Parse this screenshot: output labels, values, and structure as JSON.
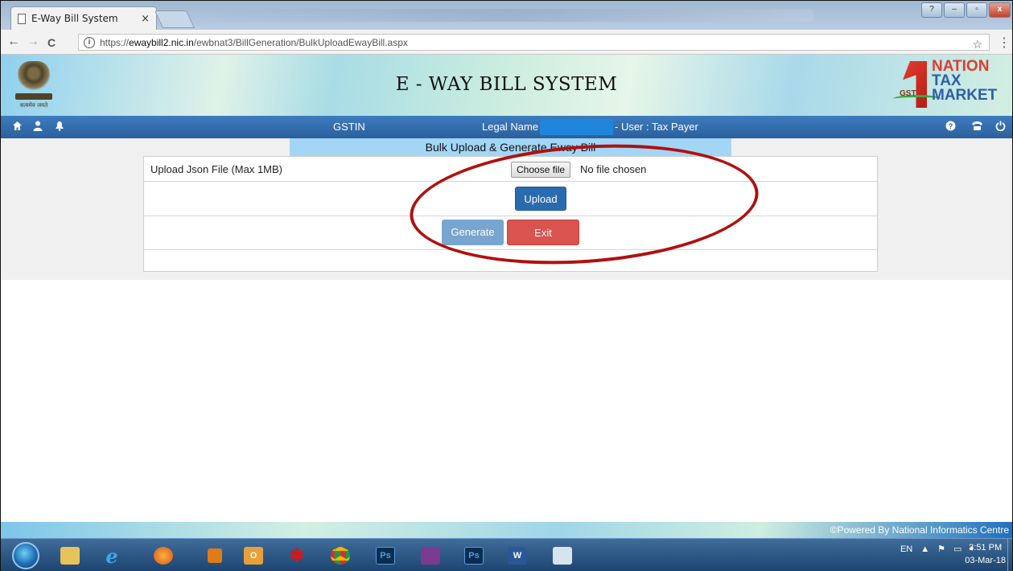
{
  "browser": {
    "tab_title": "E-Way Bill System",
    "tab_close": "×",
    "url_scheme": "https://",
    "url_host": "ewaybill2.nic.in",
    "url_path": "/ewbnat3/BillGeneration/BulkUploadEwayBill.aspx",
    "back_icon": "←",
    "forward_icon": "→",
    "reload_icon": "C",
    "info_icon": "i",
    "bookmark_icon": "☆",
    "menu_icon": "⋮",
    "win_minimize": "–",
    "win_maximize": "▫",
    "win_close": "x"
  },
  "header": {
    "emblem_motto": "सत्यमेव जयते",
    "system_title": "E - WAY BILL SYSTEM",
    "brand_line1": "NATION",
    "brand_line2": "TAX",
    "brand_line3": "MARKET",
    "brand_gst": "GST"
  },
  "navbar": {
    "gstin_label": "GSTIN",
    "legal_name_label": "Legal Name",
    "user_label": "- User : Tax Payer",
    "icons": [
      "home-icon",
      "user-icon",
      "bell-icon",
      "help-icon",
      "phone-icon",
      "power-icon"
    ]
  },
  "page": {
    "section_title": "Bulk Upload & Generate Eway Bill",
    "upload_label": "Upload Json File (Max 1MB)",
    "choose_file_label": "Choose file",
    "no_file_text": "No file chosen",
    "upload_button": "Upload",
    "generate_button": "Generate",
    "exit_button": "Exit"
  },
  "footer": {
    "powered_by": "©Powered By National Informatics Centre"
  },
  "taskbar": {
    "ps1": "Ps",
    "ps2": "Ps",
    "word": "W",
    "lang": "EN",
    "time": "3:51 PM",
    "date": "03-Mar-18"
  },
  "colors": {
    "nav_blue": "#2c5f9c",
    "section_header": "#a3d6f5",
    "upload_btn": "#2a6bb0",
    "generate_btn": "#78a5d0",
    "exit_btn": "#d9534f",
    "annotation": "#b01010"
  }
}
